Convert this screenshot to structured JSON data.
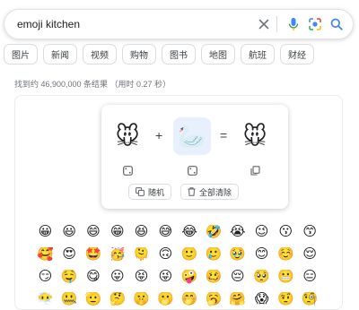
{
  "search": {
    "query": "emoji kitchen"
  },
  "icons": {
    "clear": "close-icon",
    "voice": "mic-icon",
    "lens": "camera-icon",
    "search": "search-icon"
  },
  "filters": [
    "图片",
    "新闻",
    "视频",
    "购物",
    "图书",
    "地图",
    "航班",
    "财经"
  ],
  "results_count": "找到约 46,900,000 条结果 （用时 0.27 秒）",
  "kitchen": {
    "left_emoji": "🐭",
    "plus_sign": "+",
    "right_emoji": "🦢",
    "equals_sign": "=",
    "result_emoji": "🐭",
    "random_label": "随机",
    "clear_all_label": "全部清除",
    "emoji_grid": [
      "😀",
      "😃",
      "😄",
      "😁",
      "😆",
      "😅",
      "😂",
      "🤣",
      "😭",
      "😉",
      "😗",
      "😙",
      "🥰",
      "😍",
      "🤩",
      "🥳",
      "🫠",
      "🙃",
      "🙂",
      "🥲",
      "🥹",
      "😊",
      "☺️",
      "😌",
      "😏",
      "🤤",
      "😋",
      "😛",
      "😝",
      "😜",
      "🤪",
      "🥴",
      "😔",
      "🥺",
      "😬",
      "😑",
      "😶‍🌫️",
      "🤐",
      "🫡",
      "🤔",
      "🤫",
      "🫢",
      "🤭",
      "🥱",
      "🤗",
      "😱",
      "🤨",
      "🧐"
    ]
  }
}
